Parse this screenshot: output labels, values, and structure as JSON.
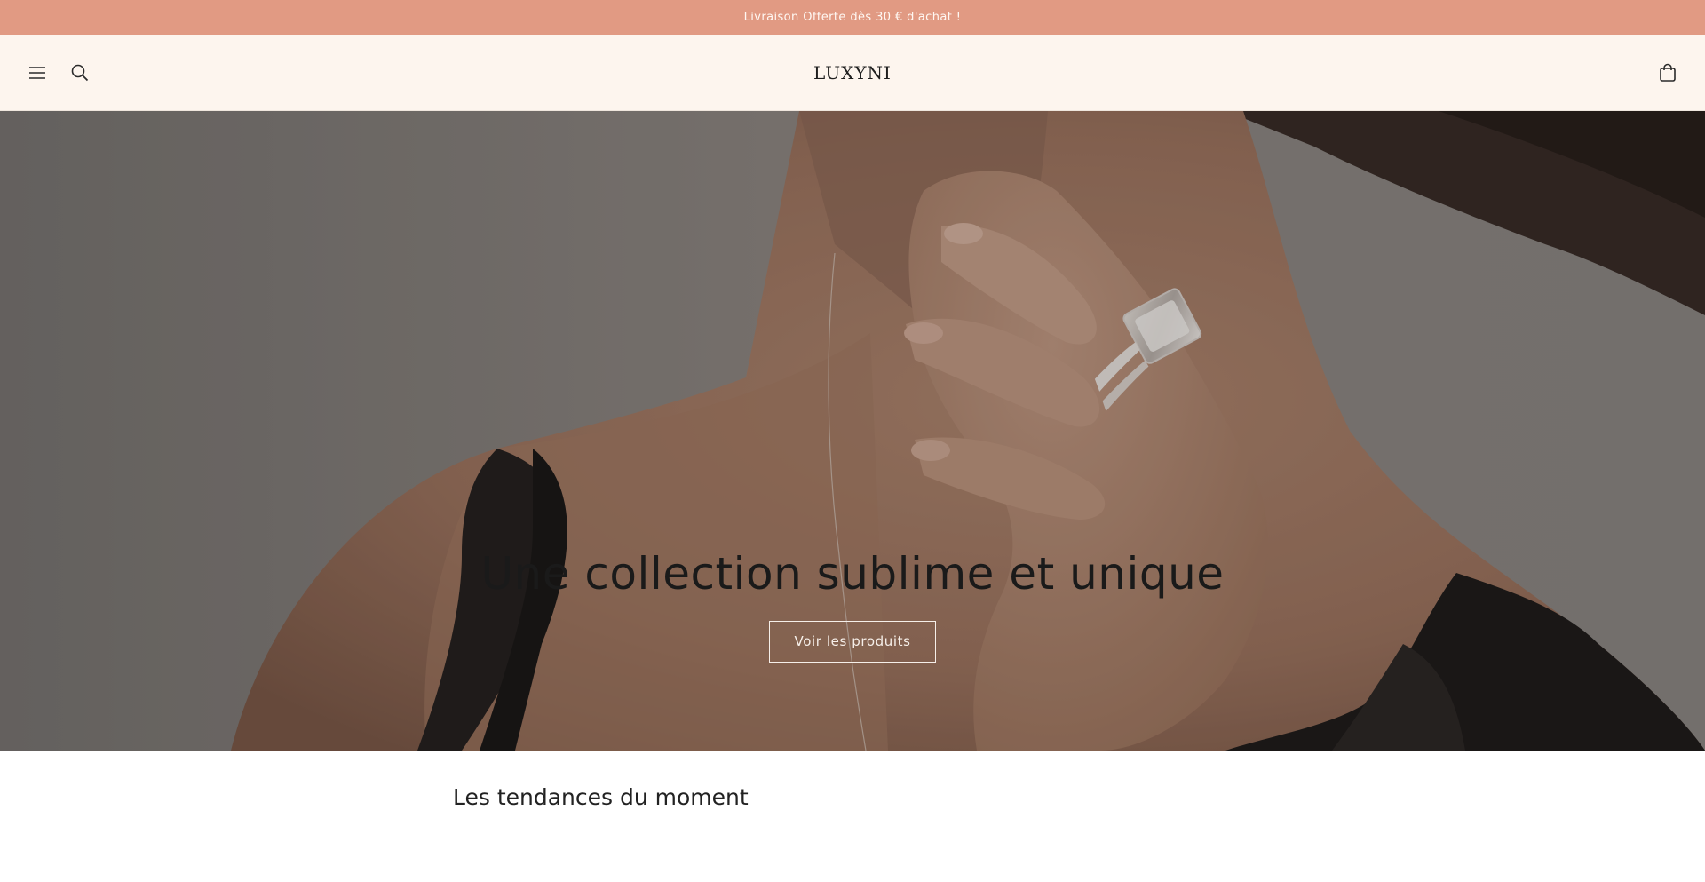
{
  "announcement": {
    "text": "Livraison Offerte dès 30 € d'achat !"
  },
  "header": {
    "logo": "LUXYNI",
    "icons": {
      "menu": "menu-icon",
      "search": "search-icon",
      "cart": "cart-icon"
    }
  },
  "hero": {
    "title": "Une collection sublime et unique",
    "button_label": "Voir les produits"
  },
  "section": {
    "title": "Les tendances du moment"
  },
  "colors": {
    "announcement_bg": "#e19a83",
    "header_bg": "#fdf5ee",
    "hero_overlay": "#000000",
    "text_primary": "#1e1e1e"
  }
}
